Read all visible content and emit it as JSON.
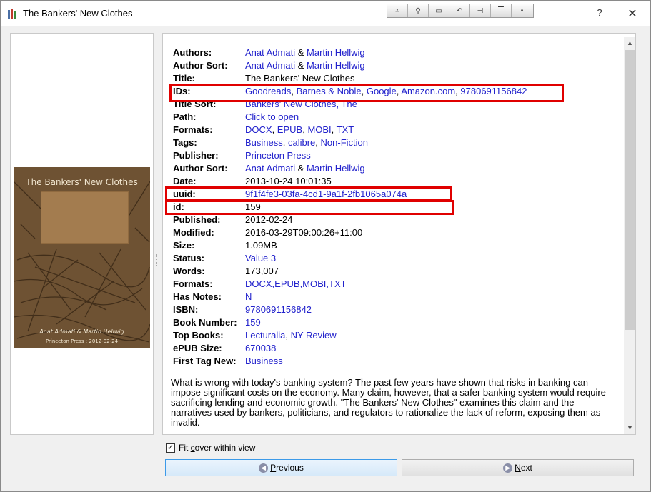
{
  "window": {
    "title": "The Bankers' New Clothes",
    "help_label": "?",
    "close_label": "✕"
  },
  "cover": {
    "title": "The Bankers' New Clothes",
    "author": "Anat Admati & Martin Hellwig",
    "publisher_line": "Princeton Press : 2012-02-24"
  },
  "fields": [
    {
      "label": "Authors:",
      "parts": [
        {
          "t": "Anat Admati",
          "link": true
        },
        {
          "t": " & ",
          "link": false
        },
        {
          "t": "Martin Hellwig",
          "link": true
        }
      ]
    },
    {
      "label": "Author Sort:",
      "parts": [
        {
          "t": "Anat Admati",
          "link": true
        },
        {
          "t": " & ",
          "link": false
        },
        {
          "t": "Martin Hellwig",
          "link": true
        }
      ]
    },
    {
      "label": "Title:",
      "parts": [
        {
          "t": "The Bankers' New Clothes",
          "link": false
        }
      ]
    },
    {
      "label": "IDs:",
      "parts": [
        {
          "t": "Goodreads",
          "link": true
        },
        {
          "t": ", ",
          "link": false
        },
        {
          "t": "Barnes & Noble",
          "link": true
        },
        {
          "t": ", ",
          "link": false
        },
        {
          "t": "Google",
          "link": true
        },
        {
          "t": ", ",
          "link": false
        },
        {
          "t": "Amazon.com",
          "link": true
        },
        {
          "t": ", ",
          "link": false
        },
        {
          "t": "9780691156842",
          "link": true
        }
      ]
    },
    {
      "label": "Title Sort:",
      "parts": [
        {
          "t": "Bankers' New Clothes, The",
          "link": true
        }
      ]
    },
    {
      "label": "Path:",
      "parts": [
        {
          "t": "Click to open",
          "link": true
        }
      ]
    },
    {
      "label": "Formats:",
      "parts": [
        {
          "t": "DOCX",
          "link": true
        },
        {
          "t": ", ",
          "link": false
        },
        {
          "t": "EPUB",
          "link": true
        },
        {
          "t": ", ",
          "link": false
        },
        {
          "t": "MOBI",
          "link": true
        },
        {
          "t": ", ",
          "link": false
        },
        {
          "t": "TXT",
          "link": true
        }
      ]
    },
    {
      "label": "Tags:",
      "parts": [
        {
          "t": "Business",
          "link": true
        },
        {
          "t": ", ",
          "link": false
        },
        {
          "t": "calibre",
          "link": true
        },
        {
          "t": ", ",
          "link": false
        },
        {
          "t": "Non-Fiction",
          "link": true
        }
      ]
    },
    {
      "label": "Publisher:",
      "parts": [
        {
          "t": "Princeton Press",
          "link": true
        }
      ]
    },
    {
      "label": "Author Sort:",
      "parts": [
        {
          "t": "Anat Admati",
          "link": true
        },
        {
          "t": " & ",
          "link": false
        },
        {
          "t": "Martin Hellwig",
          "link": true
        }
      ]
    },
    {
      "label": "Date:",
      "parts": [
        {
          "t": "2013-10-24 10:01:35",
          "link": false
        }
      ]
    },
    {
      "label": "uuid:",
      "parts": [
        {
          "t": "9f1f4fe3-03fa-4cd1-9a1f-2fb1065a074a",
          "link": true
        }
      ]
    },
    {
      "label": "id:",
      "parts": [
        {
          "t": "159",
          "link": false
        }
      ]
    },
    {
      "label": "Published:",
      "parts": [
        {
          "t": "2012-02-24",
          "link": false
        }
      ]
    },
    {
      "label": "Modified:",
      "parts": [
        {
          "t": "2016-03-29T09:00:26+11:00",
          "link": false
        }
      ]
    },
    {
      "label": "Size:",
      "parts": [
        {
          "t": "1.09MB",
          "link": false
        }
      ]
    },
    {
      "label": "Status:",
      "parts": [
        {
          "t": "Value 3",
          "link": true
        }
      ]
    },
    {
      "label": "Words:",
      "parts": [
        {
          "t": "173,007",
          "link": false
        }
      ]
    },
    {
      "label": "Formats:",
      "parts": [
        {
          "t": "DOCX,EPUB,MOBI,TXT",
          "link": true
        }
      ]
    },
    {
      "label": "Has Notes:",
      "parts": [
        {
          "t": "N",
          "link": true
        }
      ]
    },
    {
      "label": "ISBN:",
      "parts": [
        {
          "t": "9780691156842",
          "link": true
        }
      ]
    },
    {
      "label": "Book Number:",
      "parts": [
        {
          "t": "159",
          "link": true
        }
      ]
    },
    {
      "label": "Top Books:",
      "parts": [
        {
          "t": "Lecturalia",
          "link": true
        },
        {
          "t": ", ",
          "link": false
        },
        {
          "t": "NY Review",
          "link": true
        }
      ]
    },
    {
      "label": "ePUB Size:",
      "parts": [
        {
          "t": "670038",
          "link": true
        }
      ]
    },
    {
      "label": "First Tag New:",
      "parts": [
        {
          "t": "Business",
          "link": true
        }
      ]
    }
  ],
  "comments": "What is wrong with today's banking system? The past few years have shown that risks in banking can impose significant costs on the economy. Many claim, however, that a safer banking system would require sacrificing lending and economic growth. \"The Bankers' New Clothes\" examines this claim and the narratives used by bankers, politicians, and regulators to rationalize the lack of reform, exposing them as invalid.",
  "fit_cover": {
    "label": "Fit cover within view",
    "checked": true
  },
  "buttons": {
    "previous": "Previous",
    "next": "Next"
  },
  "colors": {
    "link": "#2222cc",
    "highlight": "#e00000",
    "primary_border": "#3c9ae8"
  }
}
